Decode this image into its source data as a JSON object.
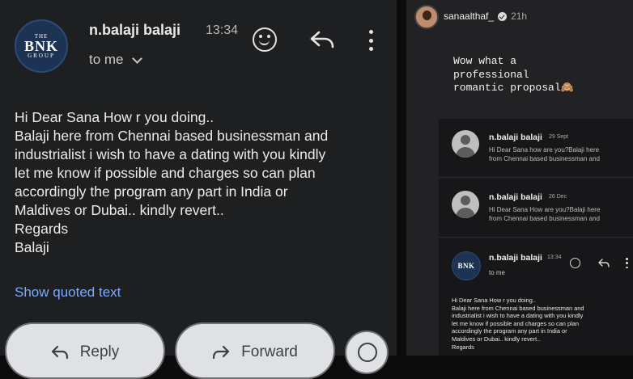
{
  "email": {
    "logo": {
      "line1": "THE",
      "line2": "BNK",
      "line3": "GROUP"
    },
    "sender": "n.balaji balaji",
    "time": "13:34",
    "recipient": "to me",
    "body": [
      "Hi Dear Sana How r you doing..",
      "Balaji here from Chennai based businessman and",
      "industrialist i wish to have a dating with you kindly",
      "let me know if possible and charges so can plan",
      "accordingly the program any part in India or",
      "Maldives or Dubai.. kindly revert..",
      "Regards",
      "Balaji"
    ],
    "show_quoted": "Show quoted text",
    "reply_label": "Reply",
    "forward_label": "Forward"
  },
  "story": {
    "username": "sanaalthaf_",
    "age": "21h",
    "caption": [
      "Wow what a",
      "professional",
      "romantic proposal🙈"
    ],
    "threads": [
      {
        "name": "n.balaji balaji",
        "date": "29 Sept",
        "snippet": [
          "Hi Dear Sana how are you?Balaji here",
          "from Chennai based businessman and"
        ]
      },
      {
        "name": "n.balaji balaji",
        "date": "26 Dec",
        "snippet": [
          "Hi Dear Sana How are you?Balaji here",
          "from Chennai based businessman and"
        ]
      }
    ],
    "open_mail": {
      "logo": "BNK",
      "name": "n.balaji balaji",
      "time": "13:34",
      "recipient": "to me",
      "body": [
        "Hi Dear Sana How r you doing..",
        "Balaji here from Chennai based businessman and",
        "industrialist i wish to have a dating with you kindly",
        "let me know if possible and charges so can plan",
        "accordingly the program any part in India or",
        "Maldives or Dubai.. kindly revert..",
        "Regards"
      ]
    }
  }
}
